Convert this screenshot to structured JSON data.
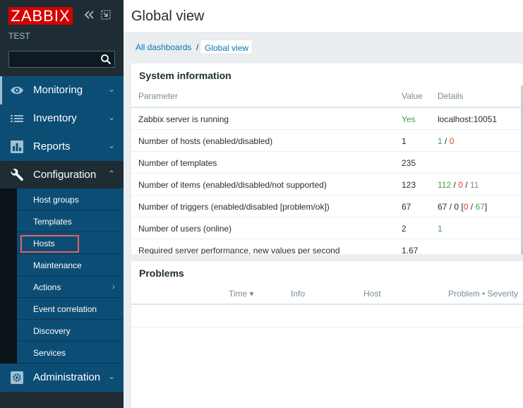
{
  "app": {
    "logo_text": "ZABBIX",
    "server_name": "TEST",
    "search_value": "",
    "colors": {
      "brand": "#d40000",
      "sidebar": "#1f2c33",
      "menu": "#0c4d75",
      "link": "#0275b8",
      "ok": "#429e47",
      "problem": "#e33734"
    }
  },
  "sidebar": {
    "menu": [
      {
        "label": "Monitoring",
        "icon": "eye-icon",
        "arrow": "⌄"
      },
      {
        "label": "Inventory",
        "icon": "list-icon",
        "arrow": "⌄"
      },
      {
        "label": "Reports",
        "icon": "bar-chart-icon",
        "arrow": "⌄"
      },
      {
        "label": "Configuration",
        "icon": "wrench-icon",
        "arrow": "⌃"
      },
      {
        "label": "Administration",
        "icon": "gear-icon",
        "arrow": "⌄"
      }
    ],
    "submenu": [
      {
        "label": "Host groups"
      },
      {
        "label": "Templates"
      },
      {
        "label": "Hosts"
      },
      {
        "label": "Maintenance"
      },
      {
        "label": "Actions",
        "arrow": "›"
      },
      {
        "label": "Event correlation"
      },
      {
        "label": "Discovery"
      },
      {
        "label": "Services"
      }
    ]
  },
  "page": {
    "title": "Global view",
    "breadcrumbs": {
      "all": "All dashboards",
      "sep": "/",
      "current": "Global view"
    }
  },
  "system_info": {
    "title": "System information",
    "headers": {
      "parameter": "Parameter",
      "value": "Value",
      "details": "Details"
    },
    "rows": [
      {
        "param": "Zabbix server is running",
        "value": "Yes",
        "details": "localhost:10051"
      },
      {
        "param": "Number of hosts (enabled/disabled)",
        "value": "1",
        "d1": "1",
        "d2": "0"
      },
      {
        "param": "Number of templates",
        "value": "235"
      },
      {
        "param": "Number of items (enabled/disabled/not supported)",
        "value": "123",
        "d1": "112",
        "d2": "0",
        "d3": "11"
      },
      {
        "param": "Number of triggers (enabled/disabled [problem/ok])",
        "value": "67",
        "d1": "67",
        "d2": "0",
        "d3": "0",
        "d4": "67"
      },
      {
        "param": "Number of users (online)",
        "value": "2",
        "d1": "1"
      },
      {
        "param": "Required server performance, new values per second",
        "value": "1.67"
      }
    ],
    "slash": "/"
  },
  "problems": {
    "title": "Problems",
    "headers": {
      "time": "Time ▾",
      "info": "Info",
      "host": "Host",
      "problem": "Problem • Severity"
    }
  }
}
